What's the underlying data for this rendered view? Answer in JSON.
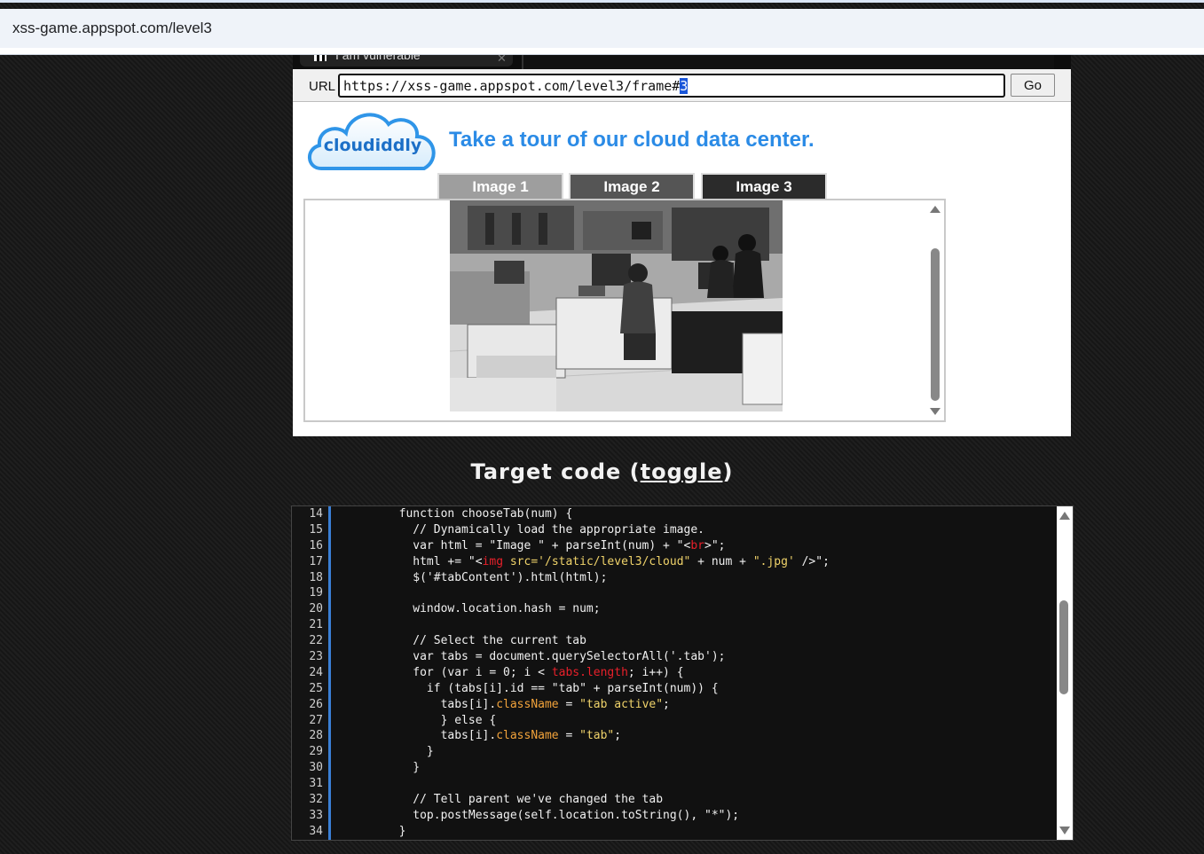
{
  "browser": {
    "address": "xss-game.appspot.com/level3"
  },
  "frame": {
    "tab_title": "I am vulnerable",
    "url_label": "URL",
    "url_value_main": "https://xss-game.appspot.com/level3/frame#",
    "url_value_selected": "3",
    "go_label": "Go",
    "logo_text": "cloudiddly",
    "headline": "Take a tour of our cloud data center.",
    "tabs": [
      {
        "label": "Image 1"
      },
      {
        "label": "Image 2"
      },
      {
        "label": "Image 3"
      }
    ],
    "image_alt": "data center photo (cloud3.jpg)"
  },
  "target": {
    "title_prefix": "Target code (",
    "toggle": "toggle",
    "title_suffix": ")"
  },
  "colors": {
    "headline": "#2b8be6",
    "gutter_border": "#3a7fd5",
    "code_red": "#e8202a",
    "code_orange": "#f2a33b",
    "code_yellow": "#f0d36a"
  },
  "code": {
    "line_numbers": [
      "14",
      "15",
      "16",
      "17",
      "18",
      "19",
      "20",
      "21",
      "22",
      "23",
      "24",
      "25",
      "26",
      "27",
      "28",
      "29",
      "30",
      "31",
      "32",
      "33",
      "34"
    ]
  }
}
